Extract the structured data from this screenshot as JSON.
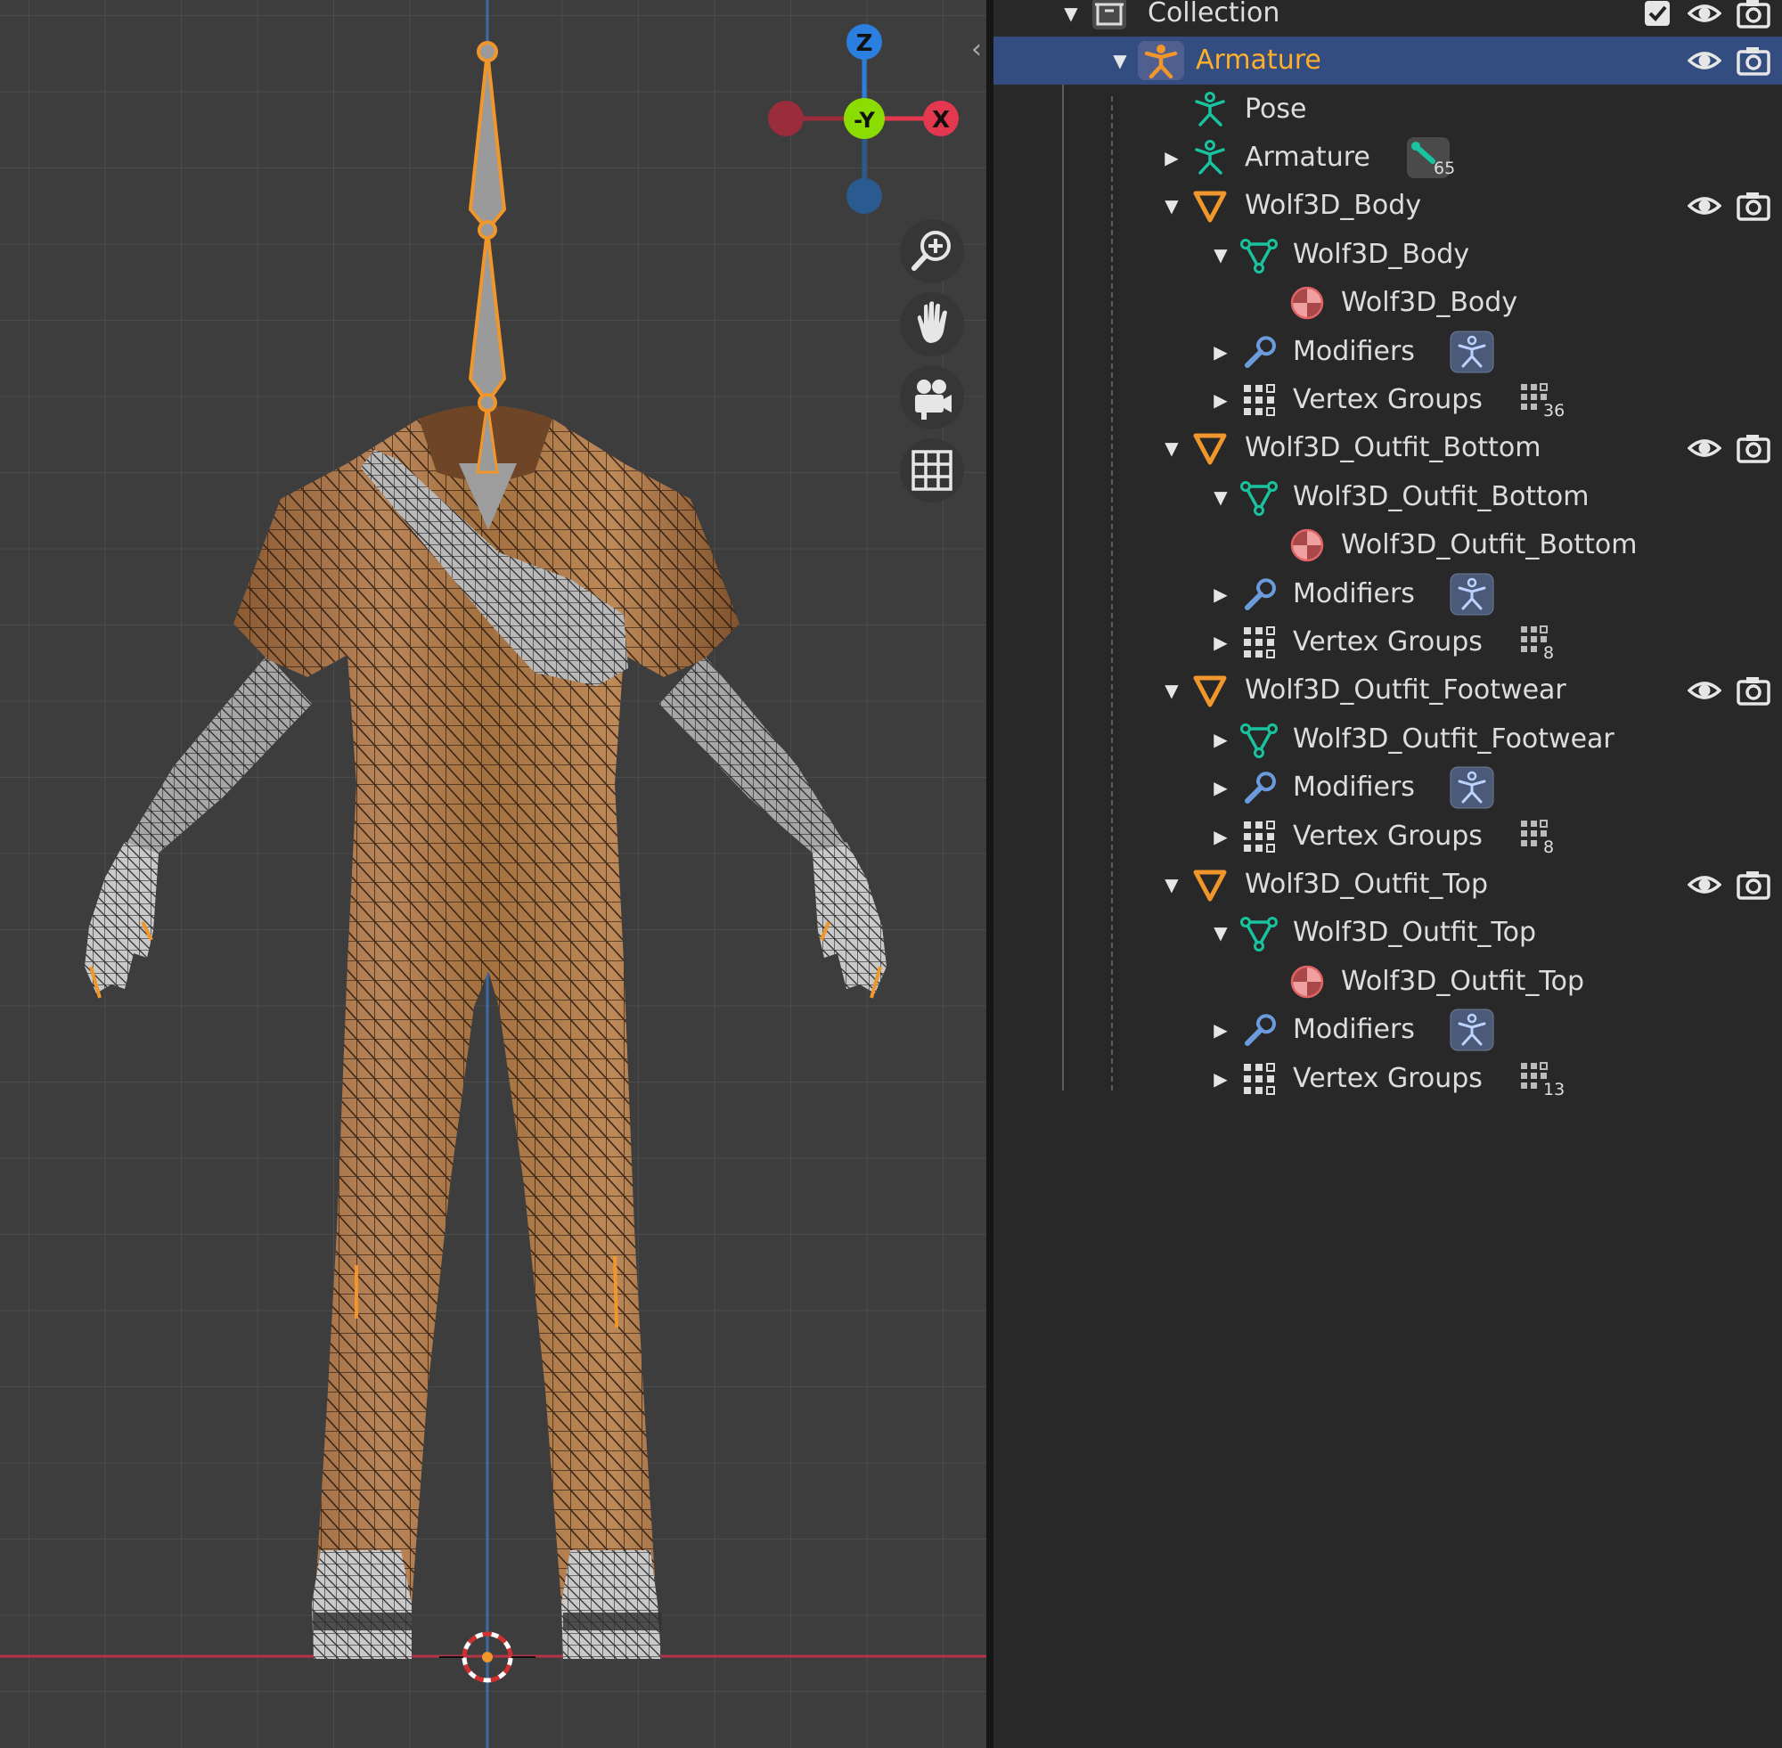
{
  "colors": {
    "viewport_bg": "#3d3d3d",
    "grid_line": "#4a4a4a",
    "outliner_bg": "#282828",
    "selection": "#334d80",
    "active_text": "#ffaf29",
    "text": "#dddddd",
    "axis_x": "#e3384f",
    "axis_y": "#8bdc00",
    "axis_z": "#2b7fe0",
    "object_orange": "#f0962a",
    "mesh_green": "#18c3a0",
    "material_red": "#e06464",
    "modifier_blue": "#6a9bdc"
  },
  "viewport": {
    "gizmo": {
      "z": "Z",
      "y": "-Y",
      "x": "X"
    },
    "nav_buttons": [
      {
        "icon": "zoom-icon"
      },
      {
        "icon": "hand-pan-icon"
      },
      {
        "icon": "camera-icon"
      },
      {
        "icon": "grid-icon"
      }
    ],
    "collapse_arrow": "‹"
  },
  "outliner": {
    "collection": {
      "label": "Collection"
    },
    "armature": {
      "label": "Armature"
    },
    "pose": {
      "label": "Pose"
    },
    "armature_data": {
      "label": "Armature",
      "badge_count": "65"
    },
    "objects": [
      {
        "name": "Wolf3D_Body",
        "mesh": "Wolf3D_Body",
        "material": "Wolf3D_Body",
        "modifiers": "Modifiers",
        "vertex_groups": "Vertex Groups",
        "vg_count": "36"
      },
      {
        "name": "Wolf3D_Outfit_Bottom",
        "mesh": "Wolf3D_Outfit_Bottom",
        "material": "Wolf3D_Outfit_Bottom",
        "modifiers": "Modifiers",
        "vertex_groups": "Vertex Groups",
        "vg_count": "8"
      },
      {
        "name": "Wolf3D_Outfit_Footwear",
        "mesh": "Wolf3D_Outfit_Footwear",
        "modifiers": "Modifiers",
        "vertex_groups": "Vertex Groups",
        "vg_count": "8"
      },
      {
        "name": "Wolf3D_Outfit_Top",
        "mesh": "Wolf3D_Outfit_Top",
        "material": "Wolf3D_Outfit_Top",
        "modifiers": "Modifiers",
        "vertex_groups": "Vertex Groups",
        "vg_count": "13"
      }
    ]
  }
}
